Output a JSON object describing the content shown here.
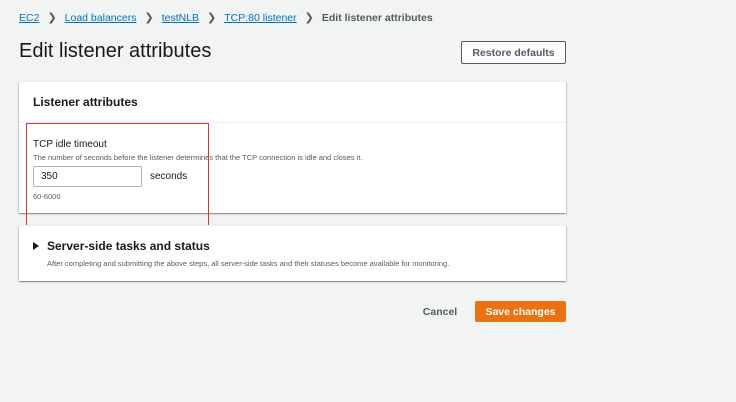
{
  "breadcrumb": {
    "items": [
      "EC2",
      "Load balancers",
      "testNLB",
      "TCP:80 listener"
    ],
    "current": "Edit listener attributes"
  },
  "page": {
    "title": "Edit listener attributes",
    "restore_label": "Restore defaults"
  },
  "attributes_panel": {
    "heading": "Listener attributes",
    "field_label": "TCP idle timeout",
    "field_description": "The number of seconds before the listener determines that the TCP connection is idle and closes it.",
    "field_value": "350",
    "unit": "seconds",
    "constraint": "60-6000"
  },
  "tasks_panel": {
    "title": "Server-side tasks and status",
    "description": "After completing and submitting the above steps, all server-side tasks and their statuses become available for monitoring."
  },
  "footer": {
    "cancel_label": "Cancel",
    "save_label": "Save changes"
  },
  "colors": {
    "link": "#0073bb",
    "primary": "#ec7211",
    "highlight": "#e22f2f",
    "background": "#f2f3f3"
  }
}
